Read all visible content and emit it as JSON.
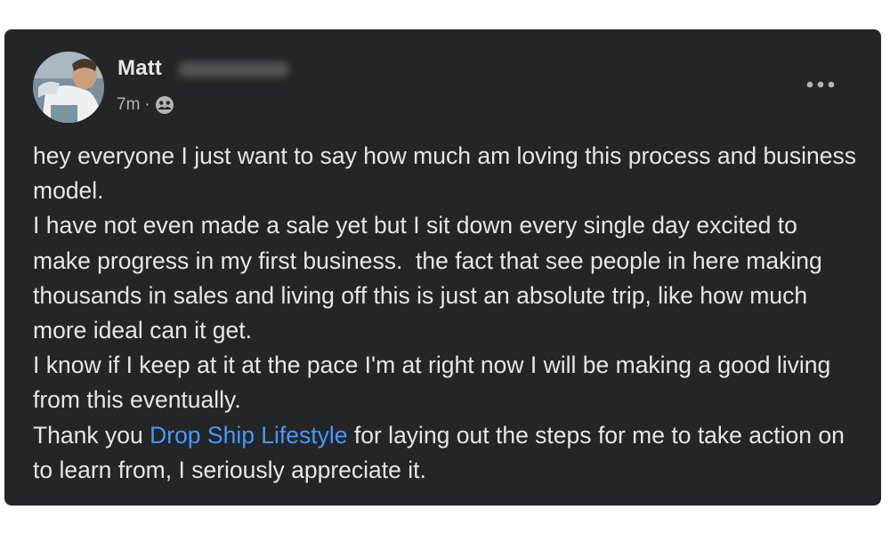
{
  "post": {
    "author": {
      "name": "Matt",
      "avatar_icon": "avatar-photo"
    },
    "time": "7m",
    "separator": "·",
    "audience_icon": "friends-icon",
    "more_icon": "more-options-icon",
    "body": {
      "line1": "hey everyone I just want to say how much am loving this process and business model.",
      "line2": "I have not even made a sale yet but I sit down every single day excited to make progress in my first business.  the fact that see people in here making thousands in sales and living off this is just an absolute trip, like how much more ideal can it get.",
      "line3": "I know if I keep at it at the pace I'm at right now I will be making a good living from this eventually.",
      "thanks_prefix": "Thank you ",
      "mention": "Drop Ship Lifestyle",
      "thanks_suffix": " for laying out the steps for me to take action on to learn from, I seriously appreciate it."
    }
  },
  "colors": {
    "card_bg": "#242526",
    "text_primary": "#e4e6eb",
    "text_secondary": "#b0b3b8",
    "link": "#4599ff"
  }
}
